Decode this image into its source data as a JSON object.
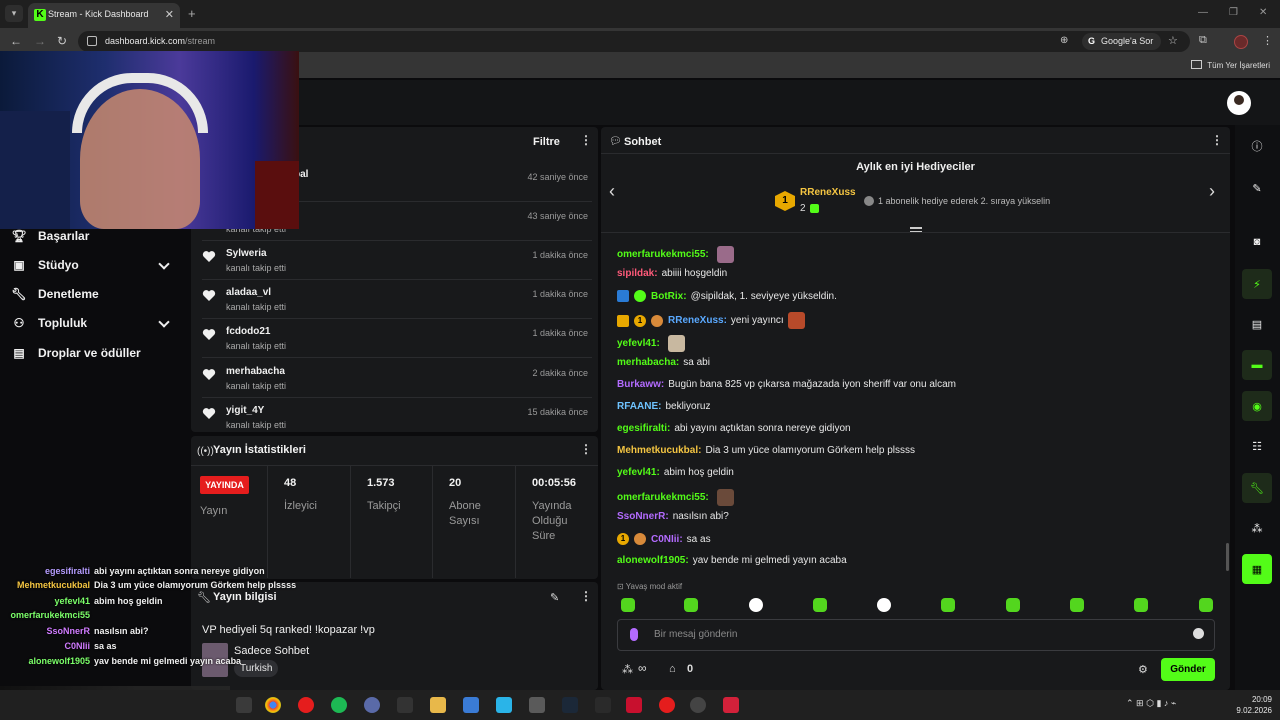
{
  "browser": {
    "tab_title": "Stream - Kick Dashboard",
    "url_host": "dashboard.kick.com",
    "url_path": "/stream",
    "search_chip": "Google'a Sor",
    "bookmarks_all": "Tüm Yer İşaretleri"
  },
  "nav": {
    "items": [
      {
        "label": "Başarılar"
      },
      {
        "label": "Stüdyo"
      },
      {
        "label": "Denetleme"
      },
      {
        "label": "Topluluk"
      },
      {
        "label": "Droplar ve ödüller"
      }
    ]
  },
  "activity": {
    "filter_label": "Filtre",
    "partial_name": "bal",
    "rows": [
      {
        "name": "",
        "sub": "kanalı takip etti",
        "time": "42 saniye önce"
      },
      {
        "name": "",
        "sub": "kanalı takip etti",
        "time": "43 saniye önce"
      },
      {
        "name": "Sylweria",
        "sub": "kanalı takip etti",
        "time": "1 dakika önce"
      },
      {
        "name": "aladaa_vl",
        "sub": "kanalı takip etti",
        "time": "1 dakika önce"
      },
      {
        "name": "fcdodo21",
        "sub": "kanalı takip etti",
        "time": "1 dakika önce"
      },
      {
        "name": "merhabacha",
        "sub": "kanalı takip etti",
        "time": "2 dakika önce"
      },
      {
        "name": "yigit_4Y",
        "sub": "kanalı takip etti",
        "time": "15 dakika önce"
      }
    ]
  },
  "stats": {
    "title": "Yayın İstatistikleri",
    "live_badge": "YAYINDA",
    "live_label": "Yayın",
    "columns": [
      {
        "value": "48",
        "label": "İzleyici"
      },
      {
        "value": "1.573",
        "label": "Takipçi"
      },
      {
        "value": "20",
        "label": "Abone Sayısı"
      },
      {
        "value": "00:05:56",
        "label": "Yayında Olduğu Süre"
      }
    ]
  },
  "info": {
    "title": "Yayın bilgisi",
    "stream_title": "VP hediyeli 5q ranked! !kopazar !vp",
    "category": "Sadece Sohbet",
    "language": "Turkish"
  },
  "chat": {
    "title": "Sohbet",
    "gifters_title": "Aylık en iyi Hediyeciler",
    "top_gifter_rank": "1",
    "top_gifter_name": "RReneXuss",
    "top_gifter_count": "2",
    "gift_hint": "1 abonelik hediye ederek 2. sıraya yükselin",
    "slow_mode": "Yavaş mod aktif",
    "input_placeholder": "Bir mesaj gönderin",
    "send_button": "Gönder",
    "infinity_count": "∞",
    "store_count": "0",
    "messages": [
      {
        "user": "omerfarukekmci55:",
        "text": "",
        "color": "#53fc18"
      },
      {
        "user": "sipildak:",
        "text": "abiiii hoşgeldin",
        "color": "#ff5a7a"
      },
      {
        "user": "BotRix:",
        "text": "@sipildak, 1. seviyeye yükseldin.",
        "color": "#53fc18"
      },
      {
        "user": "RReneXuss:",
        "text": "yeni yayıncı",
        "color": "#5aa9ff"
      },
      {
        "user": "yefevl41:",
        "text": "",
        "color": "#53fc18"
      },
      {
        "user": "merhabacha:",
        "text": "sa abi",
        "color": "#53fc18"
      },
      {
        "user": "Burkaww:",
        "text": "Bugün bana 825 vp çıkarsa mağazada iyon sheriff var onu alcam",
        "color": "#b36bff"
      },
      {
        "user": "RFAANE:",
        "text": "bekliyoruz",
        "color": "#6ec3ff"
      },
      {
        "user": "egesifiralti:",
        "text": "abi yayını açtıktan sonra nereye gidiyon",
        "color": "#53fc18"
      },
      {
        "user": "Mehmetkucukbal:",
        "text": "Dia 3 um yüce olamıyorum Görkem help plssss",
        "color": "#f4c542"
      },
      {
        "user": "yefevl41:",
        "text": "abim hoş geldin",
        "color": "#53fc18"
      },
      {
        "user": "omerfarukekmci55:",
        "text": "",
        "color": "#53fc18"
      },
      {
        "user": "SsoNnerR:",
        "text": "nasılsın abi?",
        "color": "#b36bff"
      },
      {
        "user": "C0NIii:",
        "text": "sa as",
        "color": "#b36bff"
      },
      {
        "user": "alonewolf1905:",
        "text": "yav bende mi gelmedi yayın acaba",
        "color": "#53fc18"
      }
    ]
  },
  "overlay_chat": [
    {
      "user": "egesifiralti",
      "text": "abi yayını açtıktan sonra nereye gidiyon",
      "color": "#b59cff"
    },
    {
      "user": "Mehmetkucukbal",
      "text": "Dia 3 um yüce olamıyorum Görkem help plssss",
      "color": "#f4c542"
    },
    {
      "user": "yefevl41",
      "text": "abim hoş geldin",
      "color": "#7cff6a"
    },
    {
      "user": "omerfarukekmci55",
      "text": "",
      "color": "#7cff6a"
    },
    {
      "user": "SsoNnerR",
      "text": "nasılsın abi?",
      "color": "#d07bff"
    },
    {
      "user": "C0NIii",
      "text": "sa as",
      "color": "#d07bff"
    },
    {
      "user": "alonewolf1905",
      "text": "yav bende mi gelmedi yayın acaba",
      "color": "#7cff6a"
    }
  ],
  "taskbar": {
    "time": "20:09",
    "date": "9.02.2026"
  },
  "colors": {
    "accent": "#53fc18",
    "live": "#e51d1d",
    "panel": "#18191b"
  }
}
